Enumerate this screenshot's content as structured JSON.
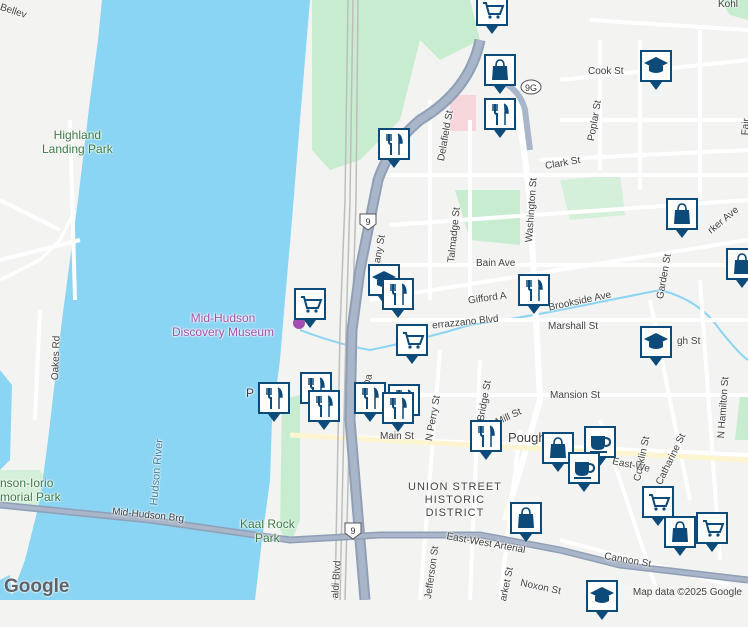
{
  "map": {
    "colors": {
      "water": "#8ad4f4",
      "land": "#f3f3f1",
      "park": "#c8ecd0",
      "highway": "#8f9fb6",
      "road": "#ffffff",
      "pin": "#0c4a7a"
    }
  },
  "labels": {
    "highland_landing_park": "Highland\nLanding Park",
    "mid_hudson_discovery_museum": "Mid-Hudson\nDiscovery Museum",
    "hudson_river": "Hudson River",
    "union_street": "UNION STREET\nHISTORIC\nDISTRICT",
    "kaal_rock_park": "Kaal Rock\nPark",
    "johnson_iorio": "nson-Iorio\nmorial Park",
    "cook_st": "Cook St",
    "poplar_st": "Poplar St",
    "clark_st": "Clark St",
    "delafield_st": "Delafield St",
    "washington_st": "Washington St",
    "talmadge_st": "Talmadge St",
    "bain_ave": "Bain Ave",
    "gifford_ave": "Gifford A",
    "brookside_ave": "Brookside Ave",
    "marshall_st": "Marshall St",
    "verrazzano_blvd": "errazzano Blvd",
    "garden_st": "Garden St",
    "parker_ave": "rker Ave",
    "mansion_st": "Mansion St",
    "mill_st": "Mill St",
    "main_st": "Main St",
    "n_perry_st": "N Perry St",
    "n_bridge_st": "N Bridge St",
    "conklin_st": "Conklin St",
    "catharine_st": "Catharine St",
    "n_hamilton_st": "N Hamilton St",
    "mid_hudson_brg": "Mid-Hudson Brg",
    "east_west_arterial": "East-West Arterial",
    "east_west_2": "East-We",
    "cannon_st": "Cannon St",
    "noxon_st": "Noxon St",
    "market_st": "arket St",
    "jefferson_st": "Jefferson St",
    "oakes_rd": "Oakes Rd",
    "rinaldi_blvd": "aldi Blvd",
    "albany_st": "any St",
    "pough": "Pough",
    "kohl": "Kohl",
    "fair": "Fair",
    "bellev": "Bellev",
    "p_label": "P",
    "da_label": "Da",
    "ugh_st": "gh St"
  },
  "route_shields": [
    "9G",
    "9",
    "9"
  ],
  "pins": [
    {
      "icon": "shopping-cart-icon"
    },
    {
      "icon": "shopping-bag-icon"
    },
    {
      "icon": "restaurant-icon"
    },
    {
      "icon": "school-icon"
    },
    {
      "icon": "restaurant-icon"
    },
    {
      "icon": "shopping-bag-icon"
    },
    {
      "icon": "shopping-cart-icon"
    },
    {
      "icon": "restaurant-icon"
    },
    {
      "icon": "school-icon"
    },
    {
      "icon": "restaurant-icon"
    },
    {
      "icon": "shopping-cart-icon"
    },
    {
      "icon": "shopping-bag-icon"
    },
    {
      "icon": "restaurant-icon"
    },
    {
      "icon": "restaurant-icon"
    },
    {
      "icon": "restaurant-icon"
    },
    {
      "icon": "school-icon"
    },
    {
      "icon": "restaurant-icon"
    },
    {
      "icon": "restaurant-icon"
    },
    {
      "icon": "restaurant-icon"
    },
    {
      "icon": "restaurant-icon"
    },
    {
      "icon": "coffee-icon"
    },
    {
      "icon": "shopping-bag-icon"
    },
    {
      "icon": "coffee-icon"
    },
    {
      "icon": "shopping-bag-icon"
    },
    {
      "icon": "shopping-cart-icon"
    },
    {
      "icon": "shopping-bag-icon"
    },
    {
      "icon": "shopping-cart-icon"
    },
    {
      "icon": "school-icon"
    }
  ],
  "footer": {
    "logo": "Google",
    "attribution": "Map data ©2025 Google"
  }
}
